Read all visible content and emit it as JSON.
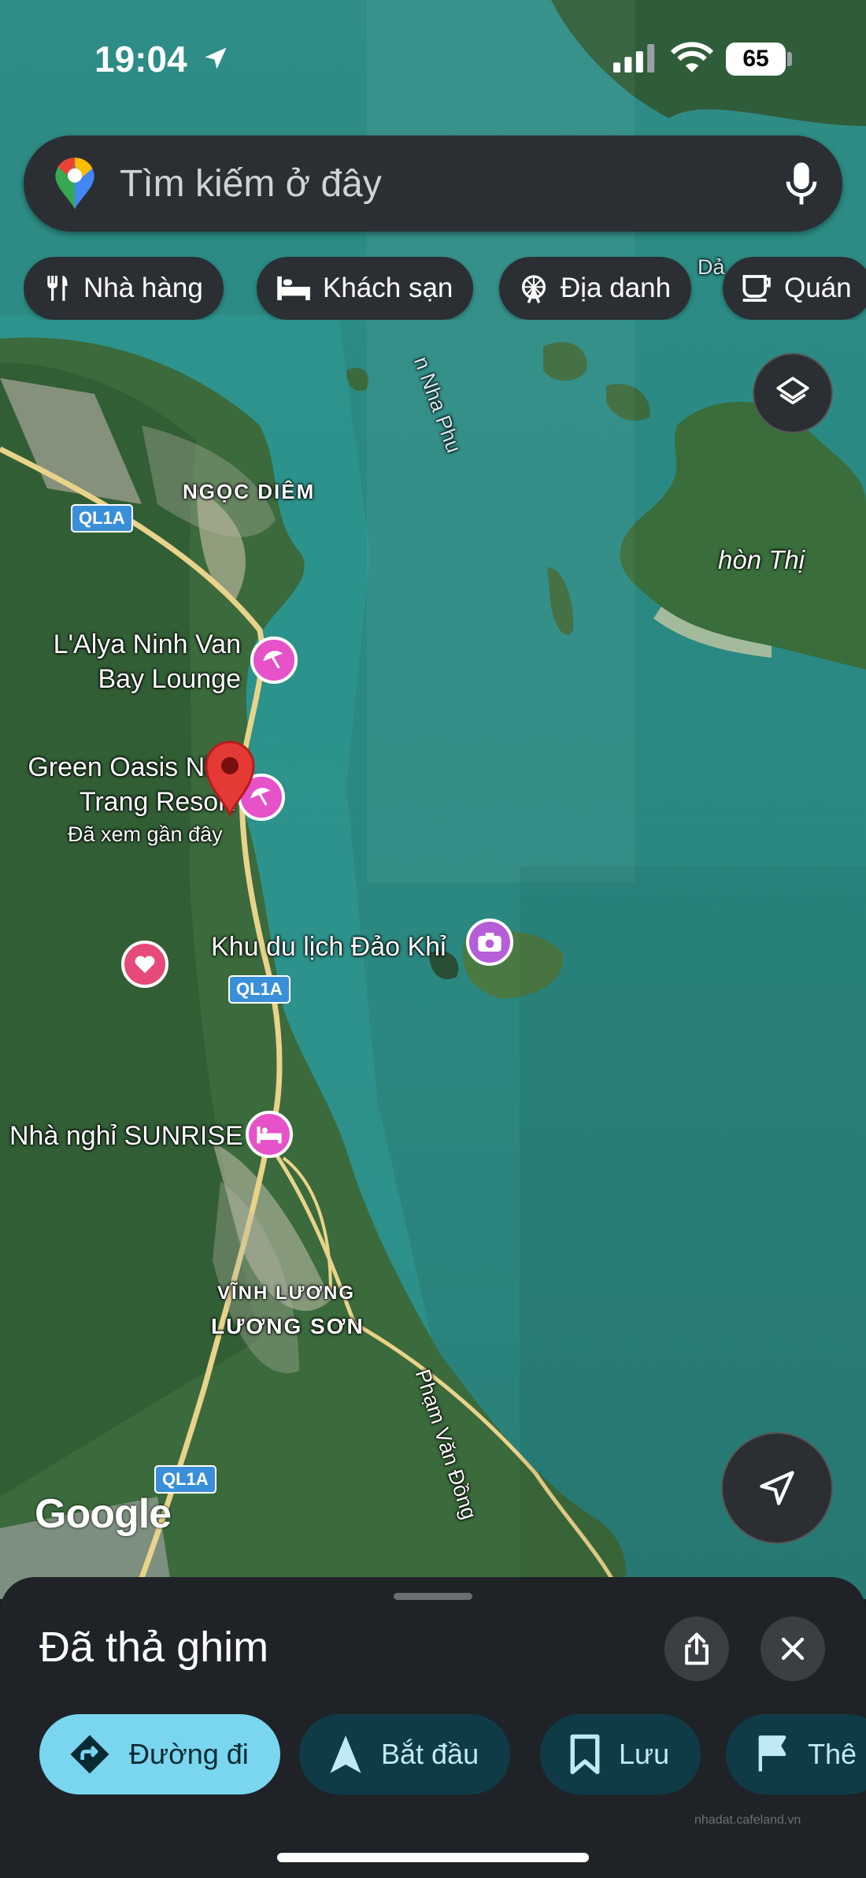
{
  "status_bar": {
    "time": "19:04",
    "battery": "65"
  },
  "search": {
    "placeholder": "Tìm kiếm ở đây"
  },
  "chips": [
    {
      "label": "Nhà hàng",
      "icon": "fork-knife-icon"
    },
    {
      "label": "Khách sạn",
      "icon": "bed-icon"
    },
    {
      "label": "Địa danh",
      "icon": "ferris-wheel-icon"
    },
    {
      "label": "Quán",
      "icon": "coffee-cup-icon"
    }
  ],
  "map": {
    "labels": {
      "ngoc_diem": "NGỌC DIÊM",
      "hon_thi": "hòn Thị",
      "nha_phu": "n Nha Phu",
      "da": "Dả",
      "lalya_line1": "L'Alya Ninh Van",
      "lalya_line2": "Bay Lounge",
      "green_oasis_line1": "Green Oasis Nha",
      "green_oasis_line2": "Trang Resort",
      "recently_viewed": "Đã xem gần đây",
      "dao_khi": "Khu du lịch Đảo Khỉ",
      "sunrise": "Nhà nghỉ SUNRISE",
      "vinh_luong": "VĨNH LƯƠNG",
      "luong_son": "LƯƠNG SƠN",
      "pham_van_dong": "Phạm Văn Đồng",
      "road_1": "QL1A",
      "road_2": "QL1A",
      "road_3": "QL1A",
      "attribution": "Google"
    },
    "colors": {
      "water": "#2a8a83",
      "land": "#3c6b3e",
      "pin": "#e53935",
      "poi_pink": "#e652c8",
      "poi_purple": "#b55ed8"
    }
  },
  "sheet": {
    "title": "Đã thả ghim",
    "actions": [
      {
        "label": "Đường đi",
        "icon": "directions-icon"
      },
      {
        "label": "Bắt đầu",
        "icon": "navigation-arrow-icon"
      },
      {
        "label": "Lưu",
        "icon": "bookmark-icon"
      },
      {
        "label": "Thê",
        "icon": "flag-icon"
      }
    ],
    "watermark": "nhadat.cafeland.vn"
  }
}
